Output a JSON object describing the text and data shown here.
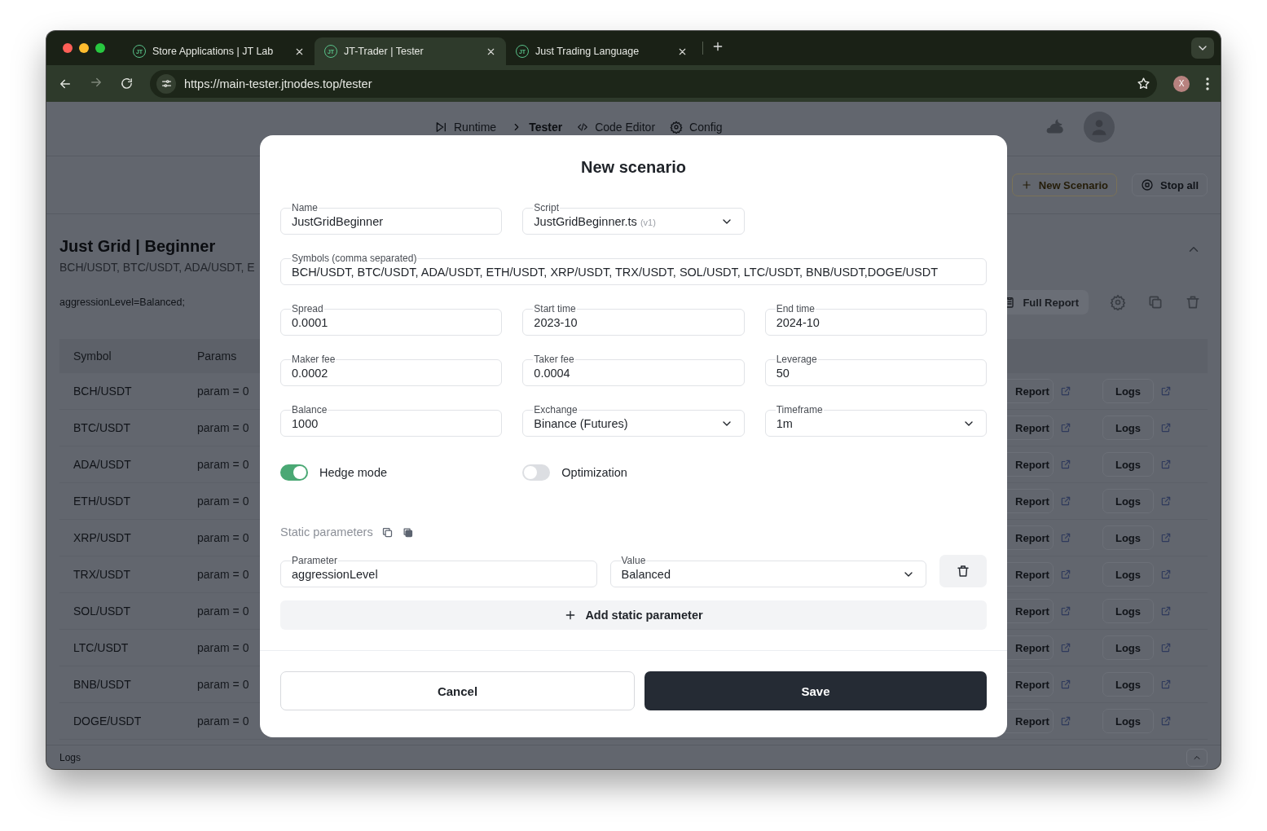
{
  "browser": {
    "tabs": [
      {
        "logo": "JT",
        "title": "Store Applications | JT Lab",
        "selected": false
      },
      {
        "logo": "JT",
        "title": "JT-Trader | Tester",
        "selected": true
      },
      {
        "logo": "JT",
        "title": "Just Trading Language",
        "selected": false
      }
    ],
    "url": "https://main-tester.jtnodes.top/tester",
    "profile": "X"
  },
  "nav": [
    {
      "label": "Runtime",
      "selected": false
    },
    {
      "label": "Tester",
      "selected": true
    },
    {
      "label": "Code Editor",
      "selected": false
    },
    {
      "label": "Config",
      "selected": false
    }
  ],
  "toolbar": {
    "new_scenario": "New Scenario",
    "stop_all": "Stop all"
  },
  "scenario": {
    "title": "Just Grid | Beginner",
    "symbols": "BCH/USDT, BTC/USDT, ADA/USDT, E",
    "params": "aggressionLevel=Balanced;",
    "full_report": "Full Report"
  },
  "table": {
    "columns": [
      "Symbol",
      "Params"
    ],
    "rows": [
      {
        "symbol": "BCH/USDT",
        "params": "param = 0",
        "report": "Report",
        "logs": "Logs"
      },
      {
        "symbol": "BTC/USDT",
        "params": "param = 0",
        "report": "Report",
        "logs": "Logs"
      },
      {
        "symbol": "ADA/USDT",
        "params": "param = 0",
        "report": "Report",
        "logs": "Logs"
      },
      {
        "symbol": "ETH/USDT",
        "params": "param = 0",
        "report": "Report",
        "logs": "Logs"
      },
      {
        "symbol": "XRP/USDT",
        "params": "param = 0",
        "report": "Report",
        "logs": "Logs"
      },
      {
        "symbol": "TRX/USDT",
        "params": "param = 0",
        "report": "Report",
        "logs": "Logs"
      },
      {
        "symbol": "SOL/USDT",
        "params": "param = 0",
        "report": "Report",
        "logs": "Logs"
      },
      {
        "symbol": "LTC/USDT",
        "params": "param = 0",
        "report": "Report",
        "logs": "Logs"
      },
      {
        "symbol": "BNB/USDT",
        "params": "param = 0",
        "report": "Report",
        "logs": "Logs"
      },
      {
        "symbol": "DOGE/USDT",
        "params": "param = 0",
        "report": "Report",
        "logs": "Logs"
      }
    ]
  },
  "footer": {
    "label": "Logs"
  },
  "dialog": {
    "title": "New scenario",
    "rows": [
      [
        {
          "kind": "text",
          "label": "Name",
          "value": "JustGridBeginner"
        },
        {
          "kind": "select",
          "label": "Script",
          "value": "JustGridBeginner.ts",
          "version": "(v1)"
        }
      ],
      [
        {
          "kind": "text",
          "label": "Symbols (comma separated)",
          "value": "BCH/USDT, BTC/USDT, ADA/USDT, ETH/USDT, XRP/USDT, TRX/USDT, SOL/USDT, LTC/USDT, BNB/USDT,DOGE/USDT"
        }
      ],
      [
        {
          "kind": "text",
          "label": "Spread",
          "value": "0.0001"
        },
        {
          "kind": "text",
          "label": "Start time",
          "value": "2023-10"
        },
        {
          "kind": "text",
          "label": "End time",
          "value": "2024-10"
        }
      ],
      [
        {
          "kind": "text",
          "label": "Maker fee",
          "value": "0.0002"
        },
        {
          "kind": "text",
          "label": "Taker fee",
          "value": "0.0004"
        },
        {
          "kind": "text",
          "label": "Leverage",
          "value": "50"
        }
      ],
      [
        {
          "kind": "text",
          "label": "Balance",
          "value": "1000"
        },
        {
          "kind": "select",
          "label": "Exchange",
          "value": "Binance (Futures)"
        },
        {
          "kind": "select",
          "label": "Timeframe",
          "value": "1m"
        }
      ]
    ],
    "toggles": [
      {
        "label": "Hedge mode",
        "on": true
      },
      {
        "label": "Optimization",
        "on": false
      }
    ],
    "static_label": "Static parameters",
    "static_params": [
      {
        "parameter_label": "Parameter",
        "parameter": "aggressionLevel",
        "value_label": "Value",
        "value": "Balanced"
      }
    ],
    "add_button": "Add static parameter",
    "cancel": "Cancel",
    "save": "Save"
  }
}
